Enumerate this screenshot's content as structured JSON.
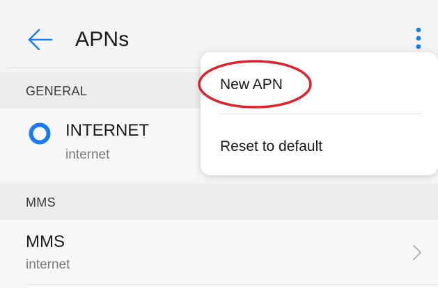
{
  "header": {
    "title": "APNs",
    "back_icon": "arrow-left-icon",
    "more_icon": "more-vertical-icon"
  },
  "sections": {
    "general": {
      "label": "GENERAL",
      "item": {
        "name": "INTERNET",
        "apn": "internet",
        "selected": true
      }
    },
    "mms": {
      "label": "MMS",
      "item": {
        "name": "MMS",
        "apn": "internet"
      }
    }
  },
  "menu": {
    "items": [
      {
        "label": "New APN",
        "highlighted": true
      },
      {
        "label": "Reset to default"
      }
    ]
  },
  "colors": {
    "accent": "#1a7cf5",
    "highlight_annotation": "#e0202a",
    "background": "#f4f4f4"
  }
}
